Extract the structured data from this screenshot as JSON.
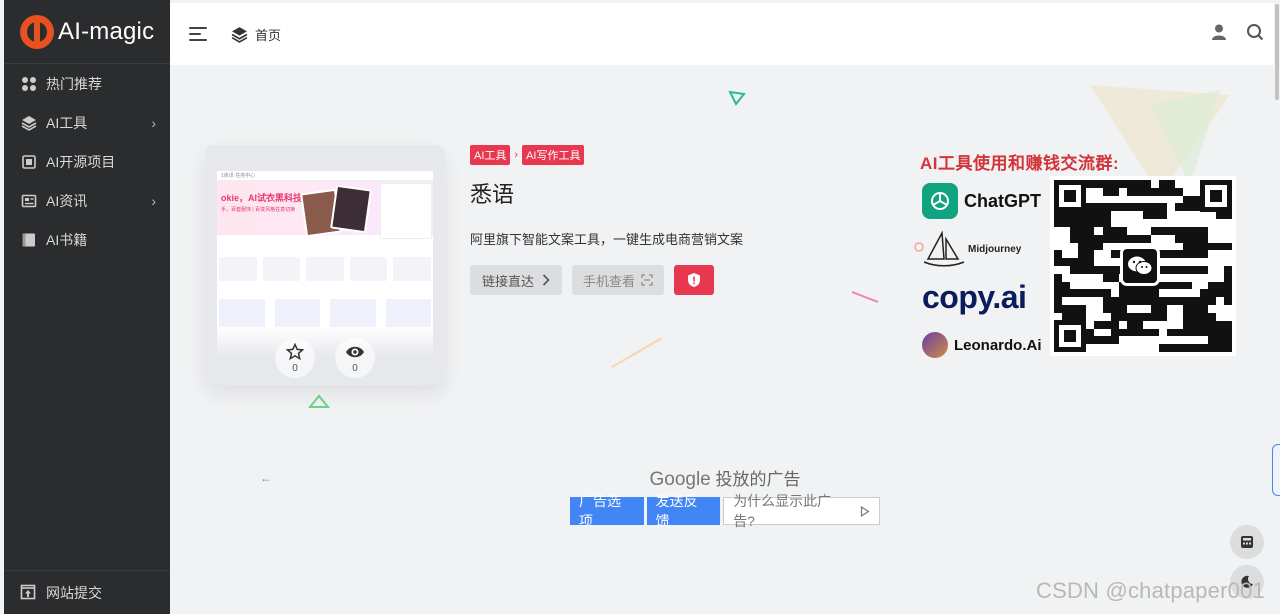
{
  "brand": {
    "logo_text": "AI-magic",
    "accent": "#e8501f"
  },
  "sidebar": {
    "items": [
      {
        "label": "热门推荐",
        "icon": "grid-icon",
        "has_submenu": false
      },
      {
        "label": "AI工具",
        "icon": "layers-icon",
        "has_submenu": true
      },
      {
        "label": "AI开源项目",
        "icon": "book-icon",
        "has_submenu": false
      },
      {
        "label": "AI资讯",
        "icon": "news-icon",
        "has_submenu": true
      },
      {
        "label": "AI书籍",
        "icon": "book-open-icon",
        "has_submenu": false
      }
    ],
    "bottom_item": {
      "label": "网站提交",
      "icon": "upload-icon"
    }
  },
  "header": {
    "breadcrumb": "首页",
    "breadcrumb_icon": "layers-icon"
  },
  "detail": {
    "tags": [
      "AI工具",
      "AI写作工具"
    ],
    "tag_separator": "›",
    "title": "悉语",
    "description": "阿里旗下智能文案工具，一键生成电商营销文案",
    "buttons": {
      "link": "链接直达",
      "mobile": "手机查看"
    },
    "stats": {
      "favorites": "0",
      "views": "0"
    }
  },
  "thumbnail": {
    "nav_text": "1资讯 任务中心",
    "hero_line1": "okie，AI试衣黑科技",
    "hero_line2": "手，百套服饰 | 百变风格任意切换"
  },
  "qr_ad": {
    "title": "AI工具使用和赚钱交流群:",
    "brands": [
      "ChatGPT",
      "Midjourney",
      "copy.ai",
      "Leonardo.Ai"
    ]
  },
  "google_ad": {
    "brand": "Google",
    "headline": "投放的广告",
    "buttons": [
      "广告选项",
      "发送反馈",
      "为什么显示此广告?"
    ],
    "back_glyph": "←"
  },
  "watermark": "CSDN @chatpaper001"
}
